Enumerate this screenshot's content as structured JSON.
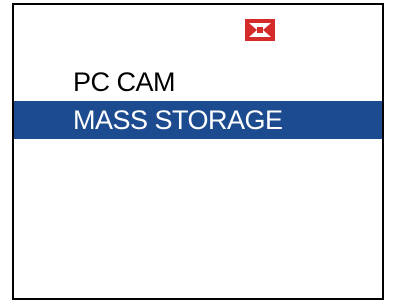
{
  "status": {
    "icon": "usb-connection-icon",
    "icon_color": "#d42a2a"
  },
  "menu": {
    "items": [
      {
        "label": "PC CAM",
        "selected": false
      },
      {
        "label": "MASS STORAGE",
        "selected": true
      }
    ],
    "highlight_color": "#1d4b8f"
  }
}
